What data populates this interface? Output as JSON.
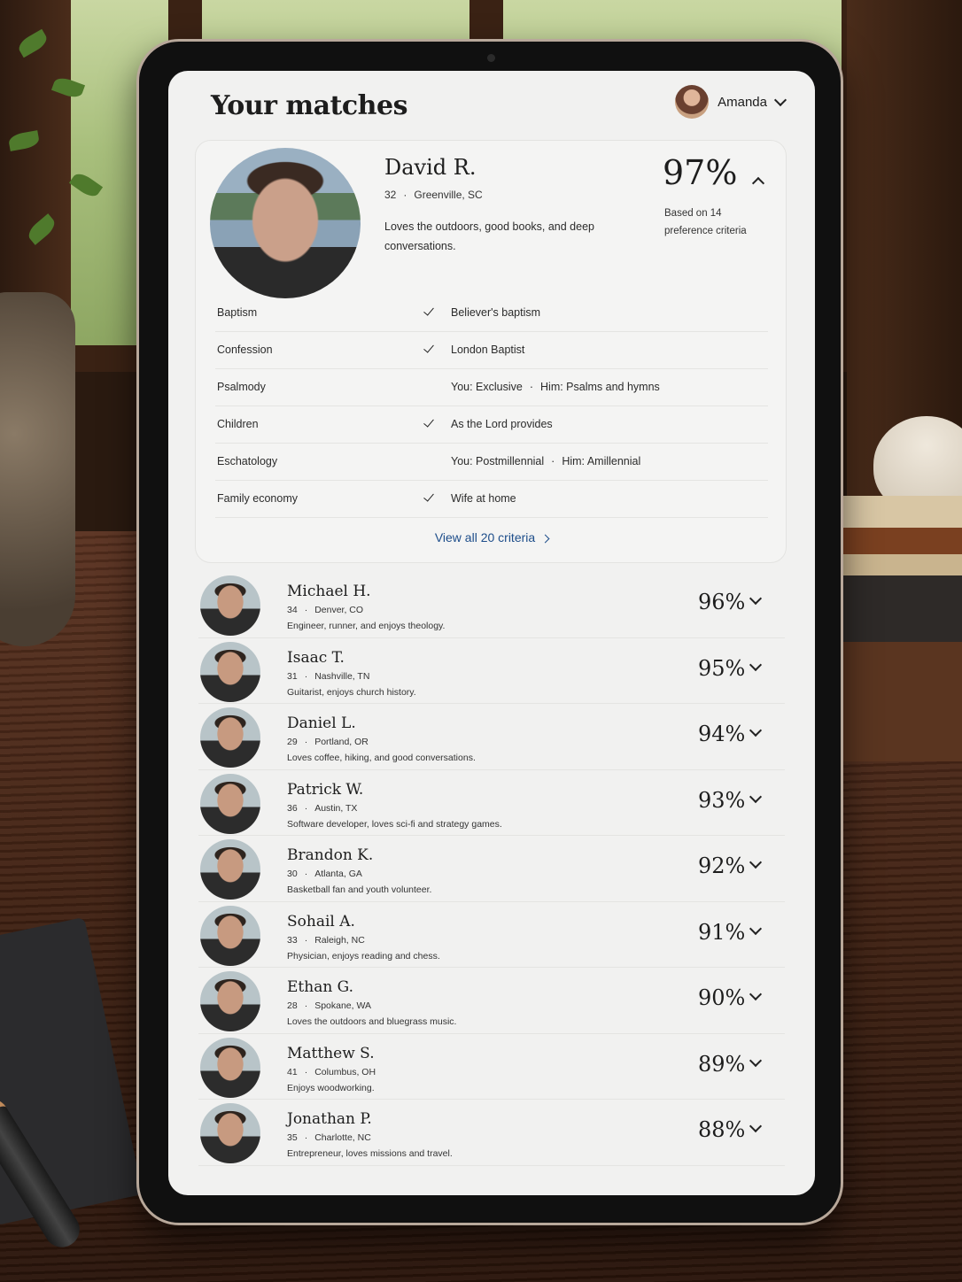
{
  "header": {
    "title": "Your matches",
    "user_name": "Amanda"
  },
  "featured": {
    "name": "David R.",
    "age": "32",
    "location": "Greenville, SC",
    "bio": "Loves the outdoors, good books, and deep conversations.",
    "match_pct": "97%",
    "basis": "Based on 14 preference criteria",
    "criteria": [
      {
        "label": "Baptism",
        "matched": true,
        "value": "Believer's baptism"
      },
      {
        "label": "Confession",
        "matched": true,
        "value": "London Baptist"
      },
      {
        "label": "Psalmody",
        "matched": false,
        "value_you": "You: Exclusive",
        "value_him": "Him: Psalms and hymns"
      },
      {
        "label": "Children",
        "matched": true,
        "value": "As the Lord provides"
      },
      {
        "label": "Eschatology",
        "matched": false,
        "value_you": "You: Postmillennial",
        "value_him": "Him: Amillennial"
      },
      {
        "label": "Family economy",
        "matched": true,
        "value": "Wife at home"
      }
    ],
    "view_all_label": "View all 20 criteria"
  },
  "separator": "·",
  "matches": [
    {
      "name": "Michael H.",
      "age": "34",
      "location": "Denver, CO",
      "bio": "Engineer, runner, and enjoys theology.",
      "pct": "96%"
    },
    {
      "name": "Isaac T.",
      "age": "31",
      "location": "Nashville, TN",
      "bio": "Guitarist, enjoys church history.",
      "pct": "95%"
    },
    {
      "name": "Daniel L.",
      "age": "29",
      "location": "Portland, OR",
      "bio": "Loves coffee, hiking, and good conversations.",
      "pct": "94%"
    },
    {
      "name": "Patrick W.",
      "age": "36",
      "location": "Austin, TX",
      "bio": "Software developer, loves sci-fi and strategy games.",
      "pct": "93%"
    },
    {
      "name": "Brandon K.",
      "age": "30",
      "location": "Atlanta, GA",
      "bio": "Basketball fan and youth volunteer.",
      "pct": "92%"
    },
    {
      "name": "Sohail A.",
      "age": "33",
      "location": "Raleigh, NC",
      "bio": "Physician, enjoys reading and chess.",
      "pct": "91%"
    },
    {
      "name": "Ethan G.",
      "age": "28",
      "location": "Spokane, WA",
      "bio": "Loves the outdoors and bluegrass music.",
      "pct": "90%"
    },
    {
      "name": "Matthew S.",
      "age": "41",
      "location": "Columbus, OH",
      "bio": "Enjoys woodworking.",
      "pct": "89%"
    },
    {
      "name": "Jonathan P.",
      "age": "35",
      "location": "Charlotte, NC",
      "bio": "Entrepreneur, loves missions and travel.",
      "pct": "88%"
    }
  ],
  "colors": {
    "accent_link": "#1d4d8a",
    "screen_bg": "#f1f1f0",
    "text": "#1d1d1d"
  },
  "icons": [
    "chevron-down-icon",
    "chevron-up-icon",
    "chevron-right-icon",
    "check-icon"
  ]
}
